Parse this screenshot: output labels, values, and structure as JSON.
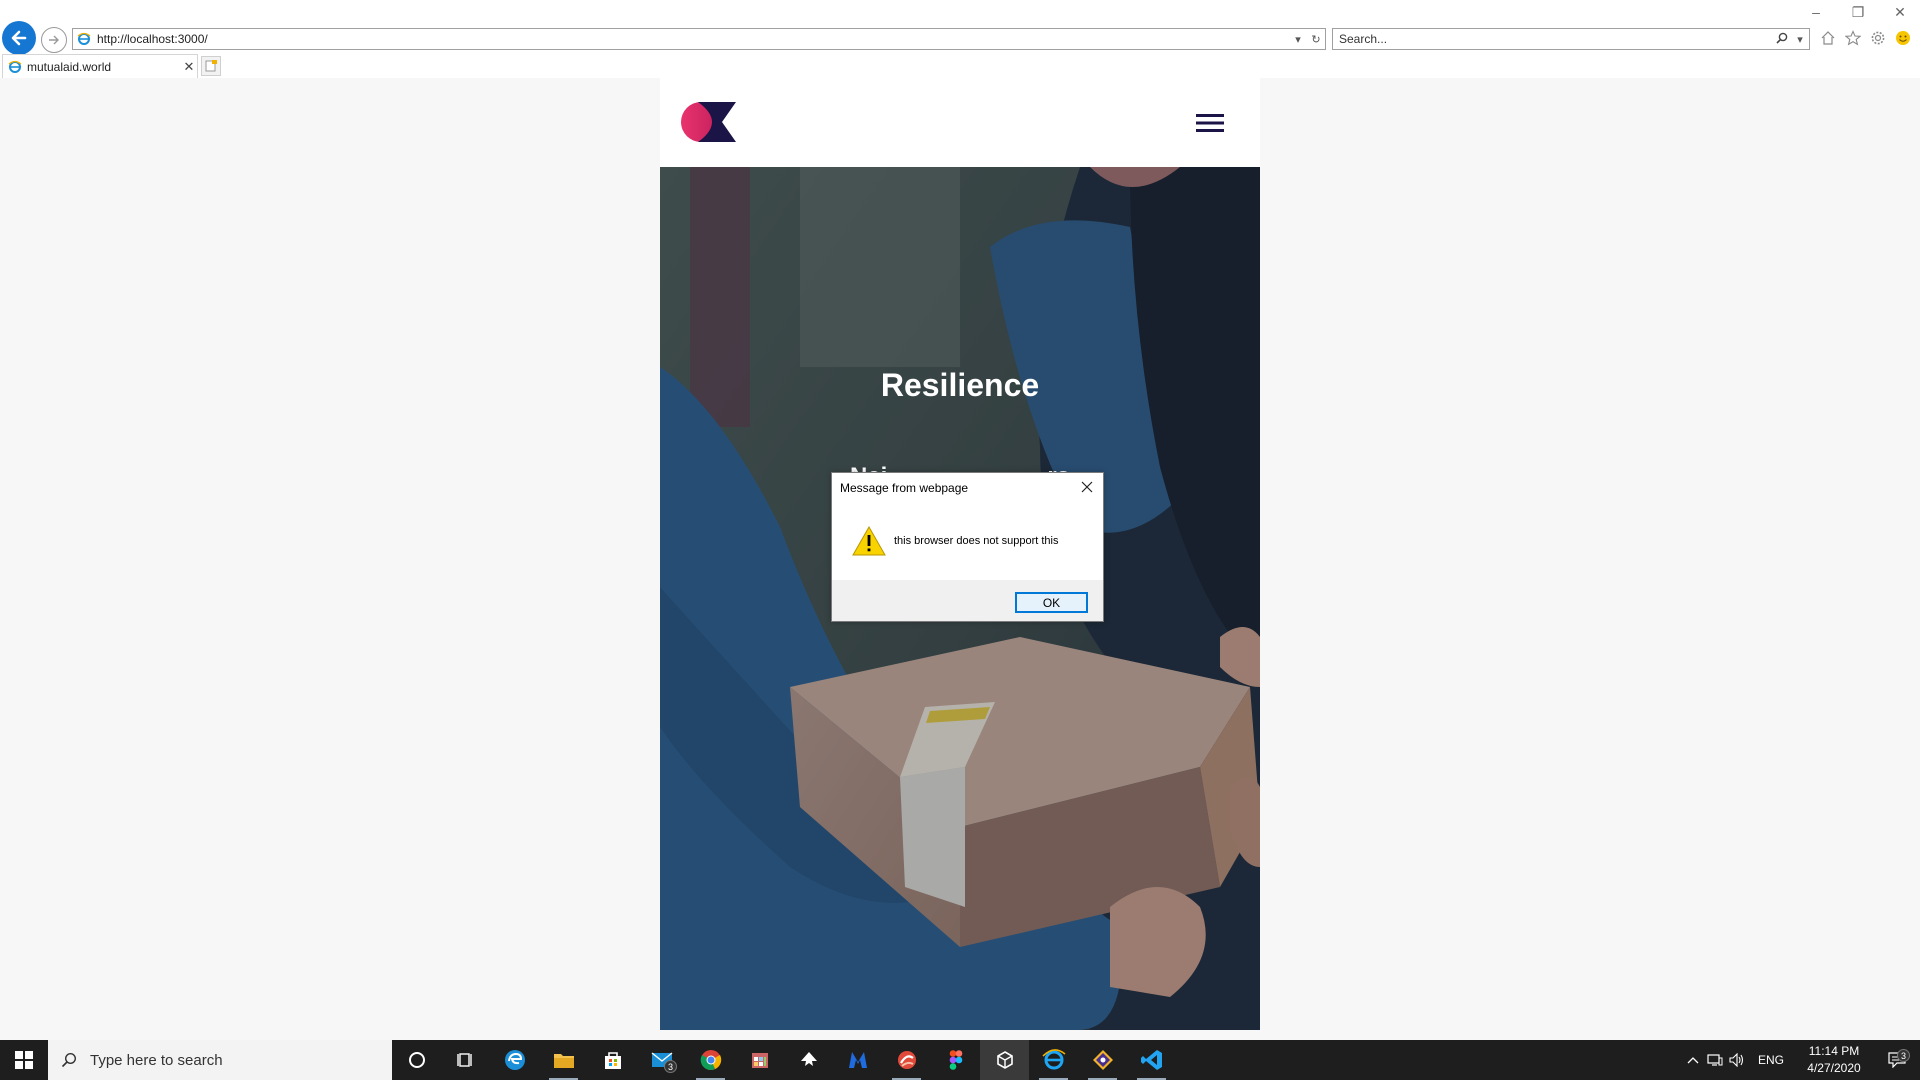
{
  "browser": {
    "url": "http://localhost:3000/",
    "search_placeholder": "Search...",
    "tab_title": "mutualaid.world"
  },
  "site": {
    "hero_title": "Resilience",
    "hero_subtitle": "Nei                        rs"
  },
  "dialog": {
    "title": "Message from webpage",
    "message": "this browser does not support this",
    "ok_label": "OK"
  },
  "taskbar": {
    "search_placeholder": "Type here to search",
    "mail_badge": "3",
    "language": "ENG",
    "time": "11:14 PM",
    "date": "4/27/2020",
    "notification_badge": "3"
  },
  "colors": {
    "accent_blue": "#1677d3",
    "logo_pink": "#e8336d",
    "logo_navy": "#1b1446",
    "dialog_ok_border": "#0078d7"
  }
}
